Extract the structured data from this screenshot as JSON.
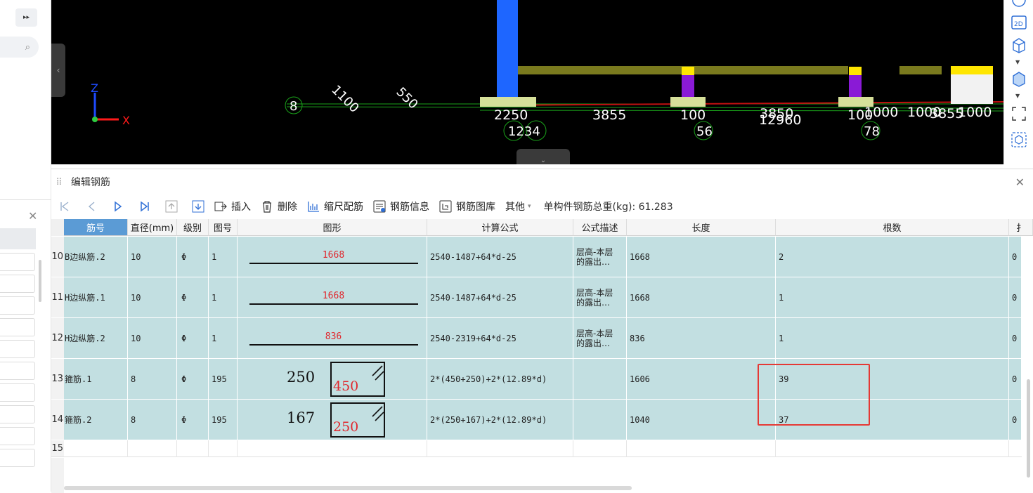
{
  "left": {
    "expand_icon": "double-chevron-right-icon",
    "expand_label": "▸▸",
    "search_icon": "search-icon",
    "search_glyph": "⌕",
    "close_glyph": "✕",
    "collapse_left_glyph": "‹",
    "collapse_bottom_glyph": "⌄"
  },
  "viewport": {
    "axis_z": "Z",
    "axis_x": "X",
    "labels": {
      "dim_a": "1100",
      "dim_b": "550",
      "circle_a": "8",
      "dim_c": "2250",
      "dim_d": "3855",
      "dim_e": "100",
      "dim_f": "3850",
      "dim_g": "12960",
      "dim_h": "100",
      "dim_i": "1000",
      "dim_j": "1000",
      "dim_k": "3855",
      "dim_l": "1000",
      "marks_a": "1234",
      "marks_b": "56",
      "marks_c": "78"
    }
  },
  "right_toolbar": {
    "btn_2d": "2D"
  },
  "panel": {
    "title": "编辑钢筋",
    "close": "✕",
    "drag_handle": "⁞⁞"
  },
  "toolbar": {
    "insert": "插入",
    "delete": "删除",
    "scale": "缩尺配筋",
    "info": "钢筋信息",
    "library": "钢筋图库",
    "other": "其他",
    "other_caret": "▾",
    "total_label": "单构件钢筋总重(kg): 61.283"
  },
  "table": {
    "headers": [
      "筋号",
      "直径(mm)",
      "级别",
      "图号",
      "图形",
      "计算公式",
      "公式描述",
      "长度",
      "根数",
      "扌"
    ],
    "rows": [
      {
        "num": "10",
        "name": "B边纵筋.2",
        "dia": "10",
        "grade": "Φ",
        "fig": "1",
        "shape_val": "1668",
        "formula": "2540-1487+64*d-25",
        "desc": "层高-本层\n的露出…",
        "len": "1668",
        "count": "2",
        "extra": "0"
      },
      {
        "num": "11",
        "name": "H边纵筋.1",
        "dia": "10",
        "grade": "Φ",
        "fig": "1",
        "shape_val": "1668",
        "formula": "2540-1487+64*d-25",
        "desc": "层高-本层\n的露出…",
        "len": "1668",
        "count": "1",
        "extra": "0"
      },
      {
        "num": "12",
        "name": "H边纵筋.2",
        "dia": "10",
        "grade": "Φ",
        "fig": "1",
        "shape_val": "836",
        "formula": "2540-2319+64*d-25",
        "desc": "层高-本层\n的露出…",
        "len": "836",
        "count": "1",
        "extra": "0"
      },
      {
        "num": "13",
        "name": "箍筋.1",
        "dia": "8",
        "grade": "Φ",
        "fig": "195",
        "shape_left": "250",
        "shape_box": "450",
        "formula": "2*(450+250)+2*(12.89*d)",
        "desc": "",
        "len": "1606",
        "count": "39",
        "extra": "0"
      },
      {
        "num": "14",
        "name": "箍筋.2",
        "dia": "8",
        "grade": "Φ",
        "fig": "195",
        "shape_left": "167",
        "shape_box": "250",
        "formula": "2*(250+167)+2*(12.89*d)",
        "desc": "",
        "len": "1040",
        "count": "37",
        "extra": "0"
      },
      {
        "num": "15"
      }
    ]
  },
  "colors": {
    "row_bg": "#c2dfe1",
    "active_header": "#5b9bd5",
    "highlight": "#e53935",
    "shape_text": "#e0282e"
  }
}
